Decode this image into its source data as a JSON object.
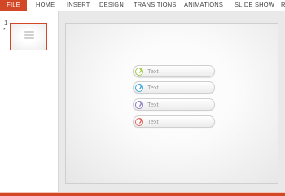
{
  "ribbon": {
    "tabs": [
      "FILE",
      "HOME",
      "INSERT",
      "DESIGN",
      "TRANSITIONS",
      "ANIMATIONS",
      "SLIDE SHOW",
      "R"
    ]
  },
  "thumbnails": {
    "slide_number": "1",
    "star": "*"
  },
  "slide": {
    "items": [
      {
        "label": "Text",
        "color": "#a5c94a"
      },
      {
        "label": "Text",
        "color": "#3aa6d8"
      },
      {
        "label": "Text",
        "color": "#8e7cc3"
      },
      {
        "label": "Text",
        "color": "#e0625b"
      }
    ]
  },
  "colors": {
    "accent": "#d24726"
  }
}
